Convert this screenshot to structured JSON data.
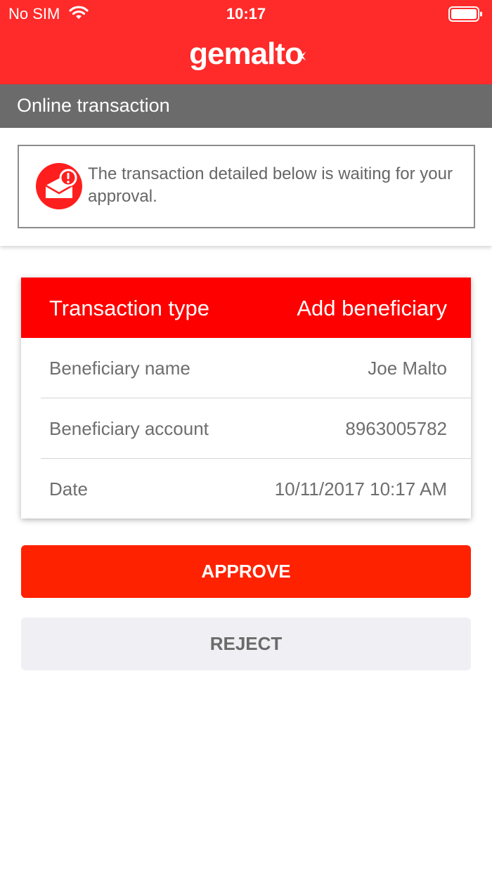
{
  "status_bar": {
    "carrier": "No SIM",
    "time": "10:17"
  },
  "header": {
    "logo_text": "gemalto"
  },
  "section": {
    "title": "Online transaction"
  },
  "notice": {
    "message": "The transaction detailed below is waiting for your approval."
  },
  "transaction": {
    "header_label": "Transaction type",
    "header_value": "Add beneficiary",
    "rows": [
      {
        "label": "Beneficiary name",
        "value": "Joe Malto"
      },
      {
        "label": "Beneficiary account",
        "value": "8963005782"
      },
      {
        "label": "Date",
        "value": "10/11/2017 10:17 AM"
      }
    ]
  },
  "actions": {
    "approve_label": "APPROVE",
    "reject_label": "REJECT"
  },
  "colors": {
    "brand_red": "#ff2a2a",
    "approve": "#ff2200",
    "section_gray": "#6b6b6b"
  },
  "icons": [
    "wifi-icon",
    "battery-icon",
    "logo-spark-icon",
    "mail-alert-icon"
  ]
}
